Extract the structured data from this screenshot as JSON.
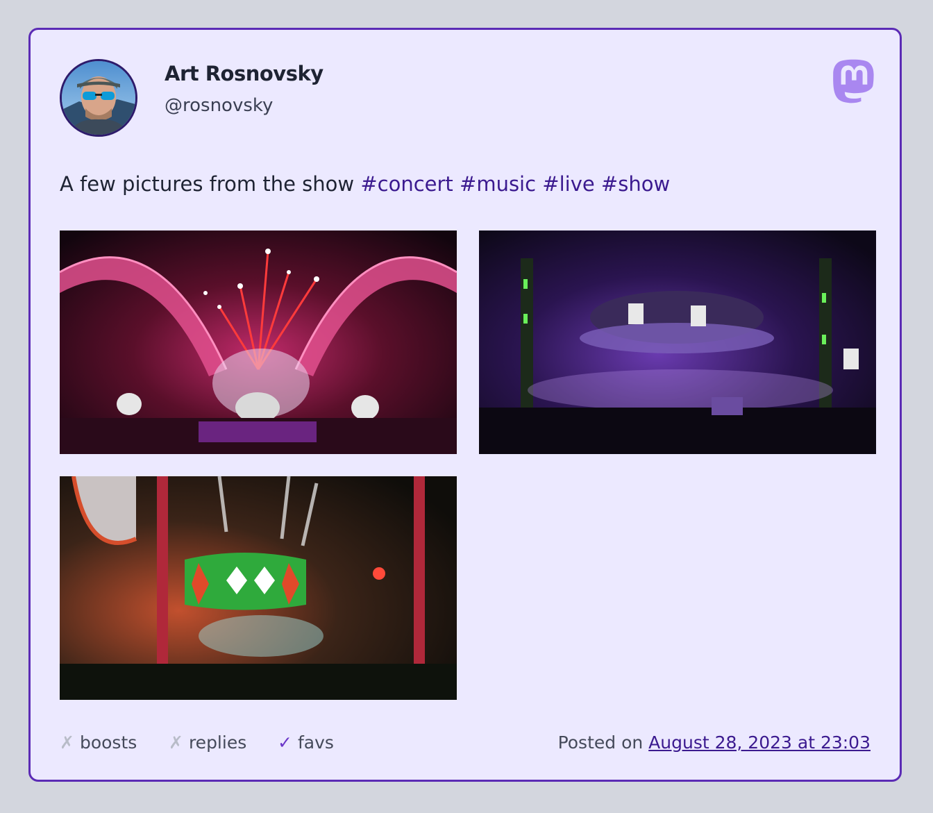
{
  "author": {
    "display_name": "Art Rosnovsky",
    "handle": "@rosnovsky"
  },
  "logo_icon": "mastodon-logo-icon",
  "post": {
    "text": "A few pictures from the show",
    "hashtags": [
      "#concert",
      "#music",
      "#live",
      "#show"
    ]
  },
  "media": [
    {
      "icon": "concert-photo-fireworks"
    },
    {
      "icon": "concert-photo-purple-stage"
    },
    {
      "icon": "concert-photo-green-screen"
    }
  ],
  "stats": {
    "boosts": {
      "mark": "✗",
      "label": "boosts"
    },
    "replies": {
      "mark": "✗",
      "label": "replies"
    },
    "favs": {
      "mark": "✓",
      "label": "favs"
    }
  },
  "posted": {
    "prefix": "Posted on",
    "date": "August 28, 2023 at 23:03"
  },
  "colors": {
    "accent": "#5b2bb5",
    "card_bg": "#ece9ff",
    "page_bg": "#d3d6de",
    "hashtag": "#3b1a8f"
  }
}
